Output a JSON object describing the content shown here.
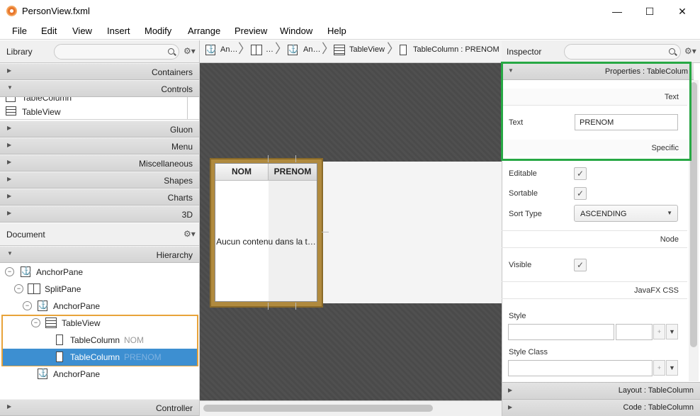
{
  "window": {
    "title": "PersonView.fxml",
    "minimize": "—",
    "maximize": "☐",
    "close": "✕"
  },
  "menu": [
    "File",
    "Edit",
    "View",
    "Insert",
    "Modify",
    "Arrange",
    "Preview",
    "Window",
    "Help"
  ],
  "library": {
    "title": "Library",
    "sections_top": [
      "Containers",
      "Controls"
    ],
    "controls_items": [
      "TableColumn",
      "TableView"
    ],
    "sections_bottom": [
      "Gluon",
      "Menu",
      "Miscellaneous",
      "Shapes",
      "Charts",
      "3D"
    ]
  },
  "document": {
    "title": "Document",
    "hierarchy_label": "Hierarchy",
    "tree": [
      {
        "label": "AnchorPane",
        "sub": ""
      },
      {
        "label": "SplitPane",
        "sub": ""
      },
      {
        "label": "AnchorPane",
        "sub": ""
      },
      {
        "label": "TableView",
        "sub": ""
      },
      {
        "label": "TableColumn",
        "sub": "NOM"
      },
      {
        "label": "TableColumn",
        "sub": "PRENOM"
      },
      {
        "label": "AnchorPane",
        "sub": ""
      }
    ],
    "controller_label": "Controller"
  },
  "breadcrumb": [
    "An…",
    "…",
    "An…",
    "TableView",
    "TableColumn : PRENOM"
  ],
  "canvas": {
    "columns": [
      "NOM",
      "PRENOM"
    ],
    "placeholder": "Aucun contenu dans la t…"
  },
  "inspector": {
    "title": "Inspector",
    "properties_header": "Properties : TableColum",
    "text_section": "Text",
    "text_label": "Text",
    "text_value": "PRENOM",
    "specific_section": "Specific",
    "editable_label": "Editable",
    "sortable_label": "Sortable",
    "sort_type_label": "Sort Type",
    "sort_type_value": "ASCENDING",
    "node_section": "Node",
    "visible_label": "Visible",
    "javafx_css_section": "JavaFX CSS",
    "style_label": "Style",
    "style_class_label": "Style Class",
    "layout_header": "Layout : TableColumn",
    "code_header": "Code : TableColumn"
  },
  "colors": {
    "selection": "#3d8fd1",
    "highlight_green": "#27a844",
    "orange_outline": "#e8a33a",
    "canvas_bg": "#4a4a4a",
    "table_frame": "#b08a3e"
  }
}
